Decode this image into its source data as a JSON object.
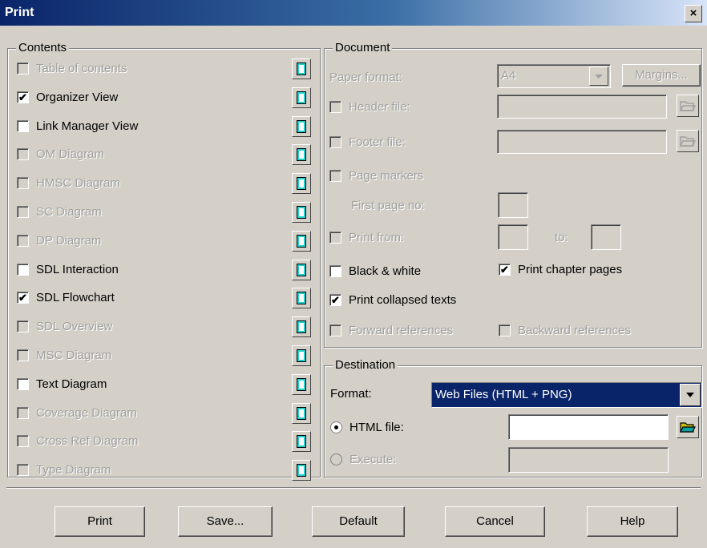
{
  "window": {
    "title": "Print",
    "close": "×"
  },
  "contents": {
    "legend": "Contents",
    "items": [
      {
        "label": "Table of contents",
        "checked": false,
        "enabled": false
      },
      {
        "label": "Organizer View",
        "checked": true,
        "enabled": true
      },
      {
        "label": "Link Manager View",
        "checked": false,
        "enabled": true
      },
      {
        "label": "OM Diagram",
        "checked": false,
        "enabled": false
      },
      {
        "label": "HMSC Diagram",
        "checked": false,
        "enabled": false
      },
      {
        "label": "SC Diagram",
        "checked": false,
        "enabled": false
      },
      {
        "label": "DP Diagram",
        "checked": false,
        "enabled": false
      },
      {
        "label": "SDL Interaction",
        "checked": false,
        "enabled": true
      },
      {
        "label": "SDL Flowchart",
        "checked": true,
        "enabled": true
      },
      {
        "label": "SDL Overview",
        "checked": false,
        "enabled": false
      },
      {
        "label": "MSC Diagram",
        "checked": false,
        "enabled": false
      },
      {
        "label": "Text Diagram",
        "checked": false,
        "enabled": true
      },
      {
        "label": "Coverage Diagram",
        "checked": false,
        "enabled": false
      },
      {
        "label": "Cross Ref Diagram",
        "checked": false,
        "enabled": false
      },
      {
        "label": "Type Diagram",
        "checked": false,
        "enabled": false
      }
    ]
  },
  "document": {
    "legend": "Document",
    "paper_format_label": "Paper format:",
    "paper_format_value": "A4",
    "margins_button": "Margins...",
    "header_file_label": "Header file:",
    "footer_file_label": "Footer file:",
    "page_markers_label": "Page markers",
    "first_page_label": "First page no:",
    "print_from_label": "Print from:",
    "to_label": "to:",
    "black_white_label": "Black & white",
    "print_chapter_label": "Print chapter pages",
    "print_collapsed_label": "Print collapsed texts",
    "forward_refs_label": "Forward references",
    "backward_refs_label": "Backward references",
    "checkmark": "✔"
  },
  "destination": {
    "legend": "Destination",
    "format_label": "Format:",
    "format_value": "Web Files (HTML + PNG)",
    "html_file_label": "HTML file:",
    "html_file_value": "",
    "execute_label": "Execute:"
  },
  "buttons": {
    "print": "Print",
    "save": "Save...",
    "default": "Default",
    "cancel": "Cancel",
    "help": "Help"
  }
}
